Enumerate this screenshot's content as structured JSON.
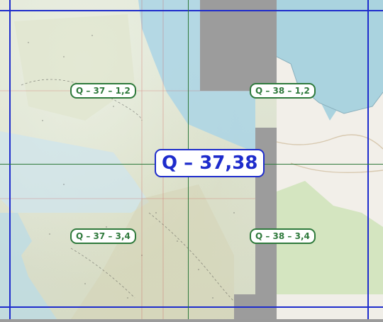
{
  "map": {
    "sheet_label": "Q – 37,38",
    "sub_labels": [
      "Q – 37 – 1,2",
      "Q – 38 – 1,2",
      "Q – 37 – 3,4",
      "Q – 38 – 3,4"
    ],
    "colors": {
      "major_grid": "#1e2ccc",
      "minor_grid": "#2f7a3c",
      "badge_text": "#2f7a3c",
      "sheet_text": "#1e2ccc",
      "water": "#a8d3e6",
      "land": "#dfe3cf",
      "osm_water": "#aad3df",
      "osm_land": "#f2efe9",
      "osm_forest": "#cfe3b9"
    }
  }
}
